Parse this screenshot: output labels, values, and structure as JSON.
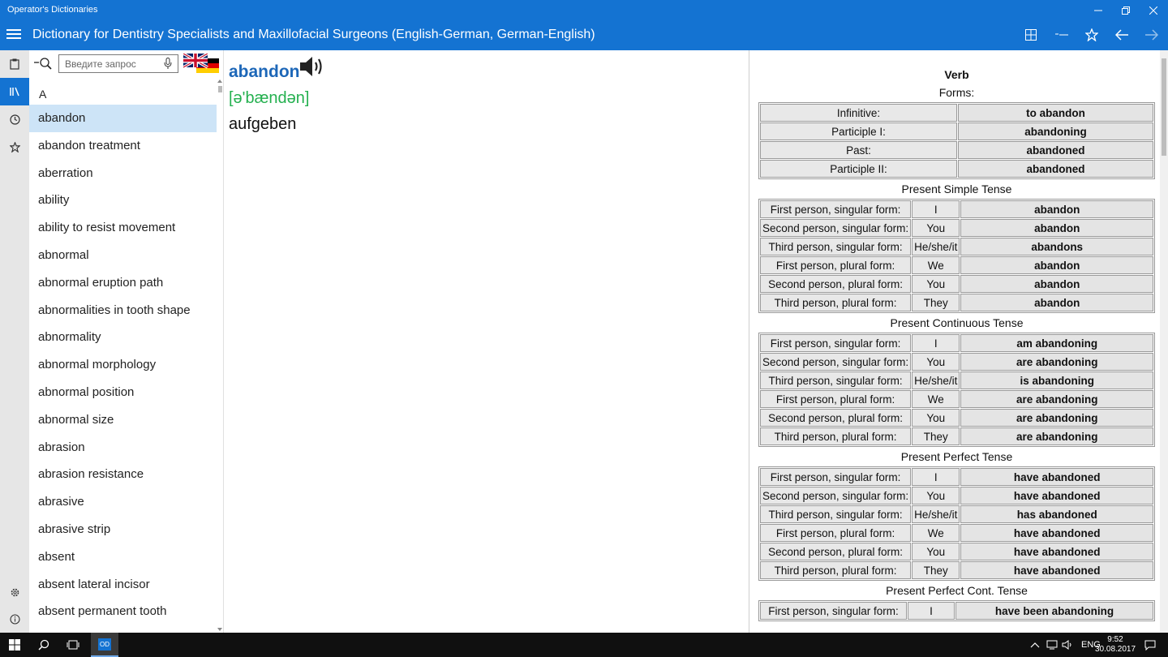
{
  "window": {
    "app_title": "Operator's Dictionaries",
    "minimize_icon": "minimize-icon",
    "maximize_icon": "maximize-icon",
    "close_icon": "close-icon"
  },
  "header": {
    "title": "Dictionary for Dentistry Specialists and Maxillofacial Surgeons (English-German, German-English)",
    "buttons": [
      "grid-icon",
      "collapse-icon",
      "star-icon",
      "back-arrow-icon",
      "forward-arrow-icon"
    ]
  },
  "rail": {
    "items": [
      "clipboard-icon",
      "library-icon",
      "history-icon",
      "favorites-icon",
      "settings-icon",
      "info-icon"
    ],
    "active": "library-icon"
  },
  "search": {
    "placeholder": "Введите запрос",
    "value": ""
  },
  "word_list": {
    "letter": "A",
    "selected": "abandon",
    "items": [
      "abandon",
      "abandon treatment",
      "aberration",
      "ability",
      "ability to resist movement",
      "abnormal",
      "abnormal eruption path",
      "abnormalities in tooth shape",
      "abnormality",
      "abnormal morphology",
      "abnormal position",
      "abnormal size",
      "abrasion",
      "abrasion resistance",
      "abrasive",
      "abrasive strip",
      "absent",
      "absent lateral incisor",
      "absent permanent tooth"
    ]
  },
  "entry": {
    "word": "abandon",
    "transcription": "[ə'bændən]",
    "translation": "aufgeben"
  },
  "grammar": {
    "part_of_speech": "Verb",
    "forms_title": "Forms:",
    "forms": [
      {
        "label": "Infinitive:",
        "value": "to abandon"
      },
      {
        "label": "Participle I:",
        "value": "abandoning"
      },
      {
        "label": "Past:",
        "value": "abandoned"
      },
      {
        "label": "Participle II:",
        "value": "abandoned"
      }
    ],
    "tenses": [
      {
        "name": "Present Simple Tense",
        "rows": [
          {
            "person": "First person, singular form:",
            "pronoun": "I",
            "form": "abandon"
          },
          {
            "person": "Second person, singular form:",
            "pronoun": "You",
            "form": "abandon"
          },
          {
            "person": "Third person, singular form:",
            "pronoun": "He/she/it",
            "form": "abandons"
          },
          {
            "person": "First person, plural form:",
            "pronoun": "We",
            "form": "abandon"
          },
          {
            "person": "Second person, plural form:",
            "pronoun": "You",
            "form": "abandon"
          },
          {
            "person": "Third person, plural form:",
            "pronoun": "They",
            "form": "abandon"
          }
        ]
      },
      {
        "name": "Present Continuous Tense",
        "rows": [
          {
            "person": "First person, singular form:",
            "pronoun": "I",
            "form": "am abandoning"
          },
          {
            "person": "Second person, singular form:",
            "pronoun": "You",
            "form": "are abandoning"
          },
          {
            "person": "Third person, singular form:",
            "pronoun": "He/she/it",
            "form": "is abandoning"
          },
          {
            "person": "First person, plural form:",
            "pronoun": "We",
            "form": "are abandoning"
          },
          {
            "person": "Second person, plural form:",
            "pronoun": "You",
            "form": "are abandoning"
          },
          {
            "person": "Third person, plural form:",
            "pronoun": "They",
            "form": "are abandoning"
          }
        ]
      },
      {
        "name": "Present Perfect Tense",
        "rows": [
          {
            "person": "First person, singular form:",
            "pronoun": "I",
            "form": "have abandoned"
          },
          {
            "person": "Second person, singular form:",
            "pronoun": "You",
            "form": "have abandoned"
          },
          {
            "person": "Third person, singular form:",
            "pronoun": "He/she/it",
            "form": "has abandoned"
          },
          {
            "person": "First person, plural form:",
            "pronoun": "We",
            "form": "have abandoned"
          },
          {
            "person": "Second person, plural form:",
            "pronoun": "You",
            "form": "have abandoned"
          },
          {
            "person": "Third person, plural form:",
            "pronoun": "They",
            "form": "have abandoned"
          }
        ]
      },
      {
        "name": "Present Perfect Cont. Tense",
        "rows": [
          {
            "person": "First person, singular form:",
            "pronoun": "I",
            "form": "have been abandoning"
          }
        ]
      }
    ]
  },
  "taskbar": {
    "language": "ENG",
    "time": "9:52",
    "date": "30.08.2017",
    "app_icon_label": "OD"
  },
  "colors": {
    "accent": "#1473d2",
    "selected_row": "#cde4f7",
    "entry_word": "#1d67b8",
    "transcription": "#24b04f"
  }
}
